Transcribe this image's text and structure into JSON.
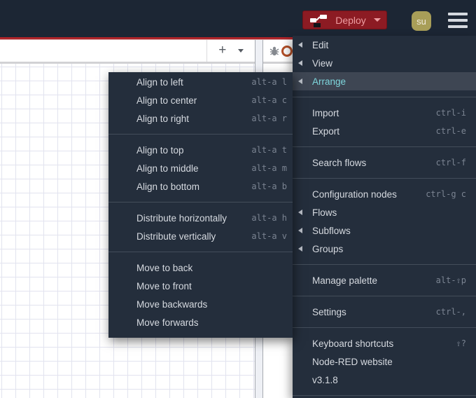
{
  "colors": {
    "header_bg": "#1c2634",
    "header_red_line": "#ac2328",
    "menu_bg": "#242e3c",
    "menu_highlight_bg": "#3e4653",
    "menu_text": "#d6dae0",
    "menu_accent_teal": "#7ed6dc",
    "shortcut_text": "#7b8492",
    "deploy_button_bg": "#8c1b23",
    "deploy_button_text": "#ee9da1",
    "avatar_bg": "#a89e58",
    "canvas_grid": "#e2e3ef",
    "badge_orange": "#b24e26"
  },
  "header": {
    "deploy_label": "Deploy",
    "user_initials": "su"
  },
  "workspace": {
    "add_flow_label": "+"
  },
  "main_menu": {
    "sections": [
      {
        "items": [
          {
            "label": "Edit",
            "submenu": true
          },
          {
            "label": "View",
            "submenu": true
          },
          {
            "label": "Arrange",
            "submenu": true,
            "active": true
          }
        ]
      },
      {
        "items": [
          {
            "label": "Import",
            "shortcut": "ctrl-i"
          },
          {
            "label": "Export",
            "shortcut": "ctrl-e"
          }
        ]
      },
      {
        "items": [
          {
            "label": "Search flows",
            "shortcut": "ctrl-f"
          }
        ]
      },
      {
        "items": [
          {
            "label": "Configuration nodes",
            "shortcut": "ctrl-g c"
          },
          {
            "label": "Flows",
            "submenu": true
          },
          {
            "label": "Subflows",
            "submenu": true
          },
          {
            "label": "Groups",
            "submenu": true
          }
        ]
      },
      {
        "items": [
          {
            "label": "Manage palette",
            "shortcut": "alt-⇧p"
          }
        ]
      },
      {
        "items": [
          {
            "label": "Settings",
            "shortcut": "ctrl-,"
          }
        ]
      },
      {
        "items": [
          {
            "label": "Keyboard shortcuts",
            "shortcut": "⇧?"
          },
          {
            "label": "Node-RED website"
          },
          {
            "label": "v3.1.8"
          }
        ]
      }
    ]
  },
  "arrange_submenu": {
    "sections": [
      {
        "items": [
          {
            "label": "Align to left",
            "shortcut": "alt-a l"
          },
          {
            "label": "Align to center",
            "shortcut": "alt-a c"
          },
          {
            "label": "Align to right",
            "shortcut": "alt-a r"
          }
        ]
      },
      {
        "items": [
          {
            "label": "Align to top",
            "shortcut": "alt-a t"
          },
          {
            "label": "Align to middle",
            "shortcut": "alt-a m"
          },
          {
            "label": "Align to bottom",
            "shortcut": "alt-a b"
          }
        ]
      },
      {
        "items": [
          {
            "label": "Distribute horizontally",
            "shortcut": "alt-a h"
          },
          {
            "label": "Distribute vertically",
            "shortcut": "alt-a v"
          }
        ]
      },
      {
        "items": [
          {
            "label": "Move to back"
          },
          {
            "label": "Move to front"
          },
          {
            "label": "Move backwards"
          },
          {
            "label": "Move forwards"
          }
        ]
      }
    ]
  }
}
